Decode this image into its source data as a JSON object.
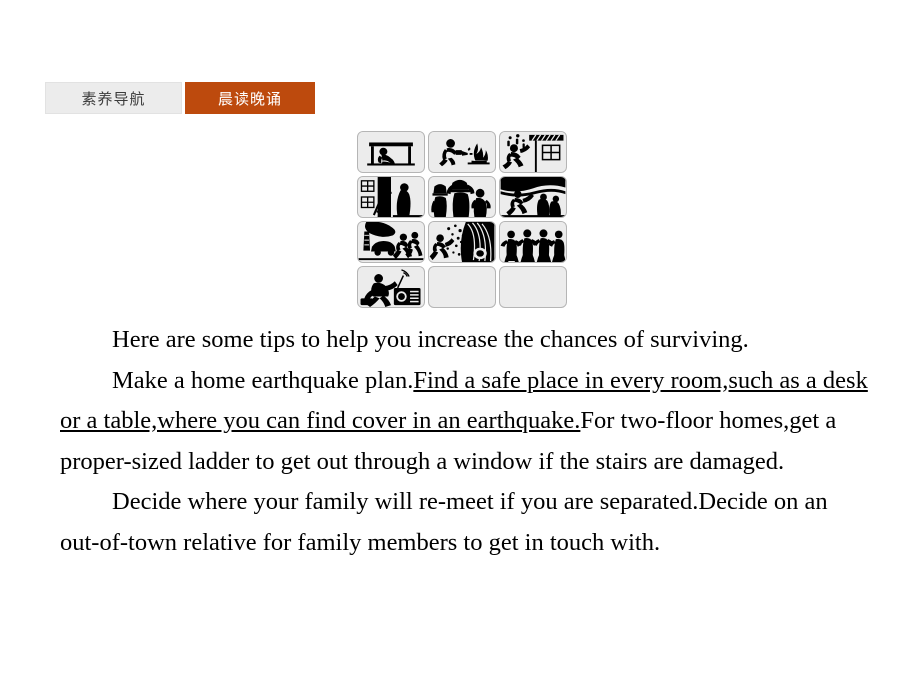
{
  "tabs": [
    {
      "label": "素养导航",
      "active": false,
      "name": "tab-literacy-navigation"
    },
    {
      "label": "晨读晚诵",
      "active": true,
      "name": "tab-morning-reading"
    }
  ],
  "colors": {
    "tab_active_bg": "#bd4a0d",
    "tab_active_text": "#ffffff",
    "tab_inactive_bg": "#ececec",
    "tab_inactive_text": "#3b3b3b",
    "picto_cell_bg": "#ececec",
    "picto_cell_border": "#b5b5b5",
    "body_text": "#000000",
    "page_bg": "#ffffff"
  },
  "pictograms": {
    "rows": 4,
    "cols": 3,
    "cells": [
      {
        "name": "picto-take-cover-under-table",
        "label": "person taking cover under a desk",
        "empty": false
      },
      {
        "name": "picto-extinguish-fire",
        "label": "person using fire extinguisher on a fire",
        "empty": false
      },
      {
        "name": "picto-flee-falling-debris",
        "label": "person running from falling debris beside a window",
        "empty": false
      },
      {
        "name": "picto-ladder-escape-window",
        "label": "ladder escape from an upper-floor window",
        "empty": false
      },
      {
        "name": "picto-protect-head-evacuate",
        "label": "people shielding heads while evacuating",
        "empty": false
      },
      {
        "name": "picto-flee-tsunami-wave",
        "label": "people fleeing a tsunami wave",
        "empty": false
      },
      {
        "name": "picto-avoid-trees-and-cars",
        "label": "people running away from falling trees and cars",
        "empty": false
      },
      {
        "name": "picto-flee-landslide",
        "label": "person fleeing a landslide",
        "empty": false
      },
      {
        "name": "picto-group-holding-hands",
        "label": "group of people holding hands while evacuating",
        "empty": false
      },
      {
        "name": "picto-listen-to-radio",
        "label": "person listening to emergency radio broadcast",
        "empty": false
      },
      {
        "name": "picto-blank-cell-1",
        "label": "",
        "empty": true
      },
      {
        "name": "picto-blank-cell-2",
        "label": "",
        "empty": true
      }
    ]
  },
  "passage": {
    "paragraph1": "Here are some tips to help you increase the chances of surviving.",
    "paragraph2": {
      "plain_start": "Make a home earthquake plan.",
      "underlined": "Find a safe place in every room,such as a desk or a table,where you can find cover in an earthquake.",
      "plain_end": "For two-floor homes,get a proper-sized ladder to get out through a window if the stairs are damaged."
    },
    "paragraph3": "Decide where your family will re-meet if you are separated.Decide on an out-of-town relative for family members to get in touch with."
  }
}
